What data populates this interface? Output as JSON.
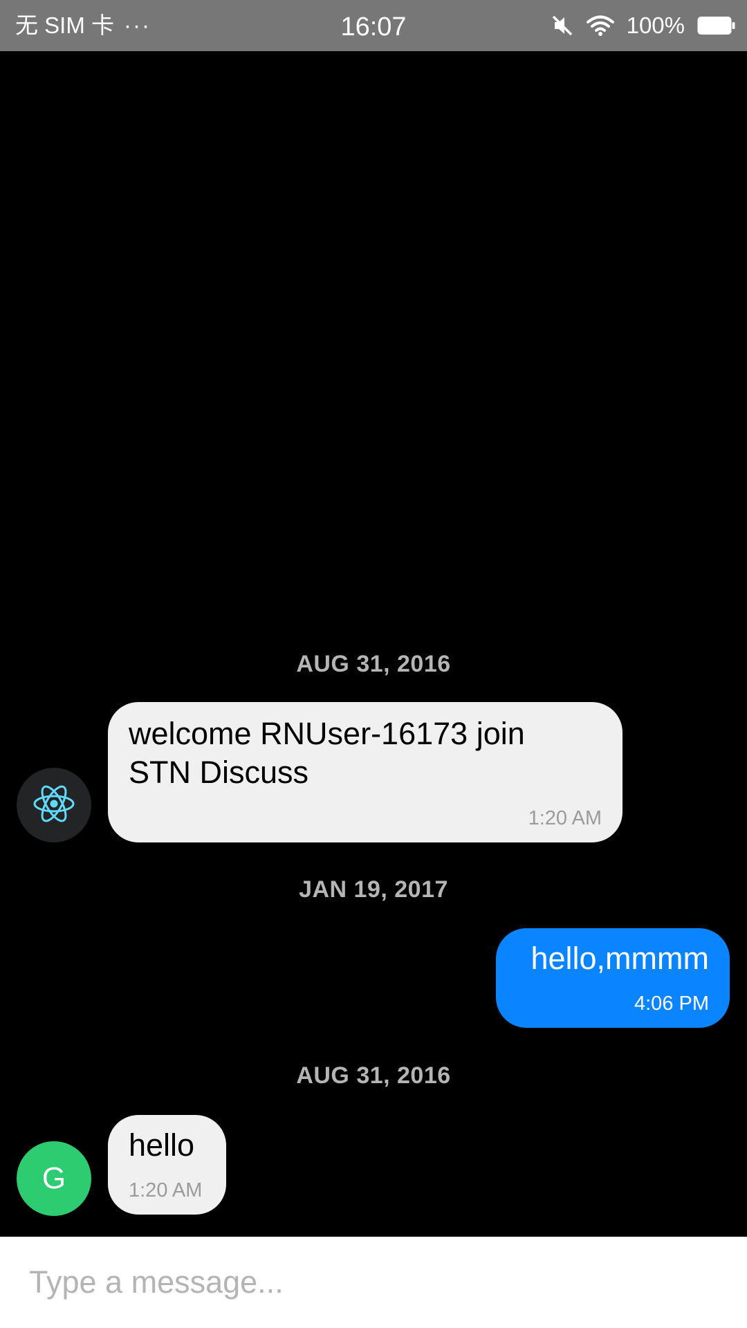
{
  "status_bar": {
    "carrier": "无 SIM 卡",
    "more_glyph": "···",
    "time": "16:07",
    "battery_percent": "100%",
    "icons": [
      "mute-icon",
      "wifi-icon",
      "battery-icon"
    ]
  },
  "messages": [
    {
      "date": "AUG 31, 2016",
      "side": "left",
      "avatar": "react-logo-icon",
      "text_line1": "welcome RNUser-16173 join",
      "text_line2": "STN Discuss",
      "time": "1:20 AM"
    },
    {
      "date": "JAN 19, 2017",
      "side": "right",
      "text": "hello,mmmm",
      "time": "4:06 PM"
    },
    {
      "date": "AUG 31, 2016",
      "side": "left",
      "avatar_letter": "G",
      "text": "hello",
      "time": "1:20 AM"
    }
  ],
  "composer": {
    "placeholder": "Type a message...",
    "value": ""
  },
  "colors": {
    "status_bar_bg": "#777777",
    "chat_bg": "#000000",
    "incoming_bubble": "#f0f0f0",
    "outgoing_bubble": "#0a84ff",
    "avatar_green": "#2ecc71",
    "react_blue": "#61dafb",
    "date_text": "#b5b5b5"
  }
}
